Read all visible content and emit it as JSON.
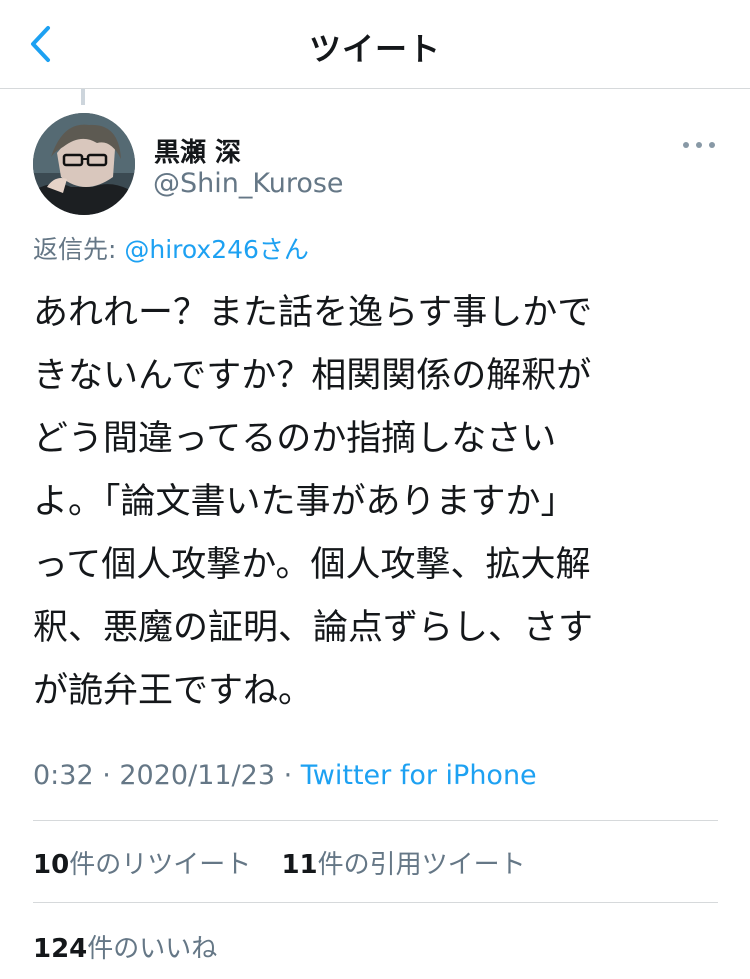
{
  "header": {
    "title": "ツイート",
    "back_icon": "chevron-left-icon"
  },
  "user": {
    "display_name": "黒瀬 深",
    "handle": "@Shin_Kurose"
  },
  "reply": {
    "prefix": "返信先: ",
    "target": "@hirox246さん"
  },
  "tweet": {
    "text": "あれれー？また話を逸らす事しかで\nきないんですか？相関関係の解釈が\nどう間違ってるのか指摘しなさい\nよ。「論文書いた事がありますか」\nって個人攻撃か。個人攻撃、拡大解\n釈、悪魔の証明、論点ずらし、さす\nが詭弁王ですね。",
    "time": "0:32 · 2020/11/23 · ",
    "source": "Twitter for iPhone"
  },
  "stats": {
    "retweets_count": "10",
    "retweets_label": "件のリツイート",
    "quotes_count": "11",
    "quotes_label": "件の引用ツイート",
    "likes_count": "124",
    "likes_label": "件のいいね"
  },
  "colors": {
    "accent": "#1da1f2",
    "secondary_text": "#657786",
    "border": "#d6d9db"
  }
}
